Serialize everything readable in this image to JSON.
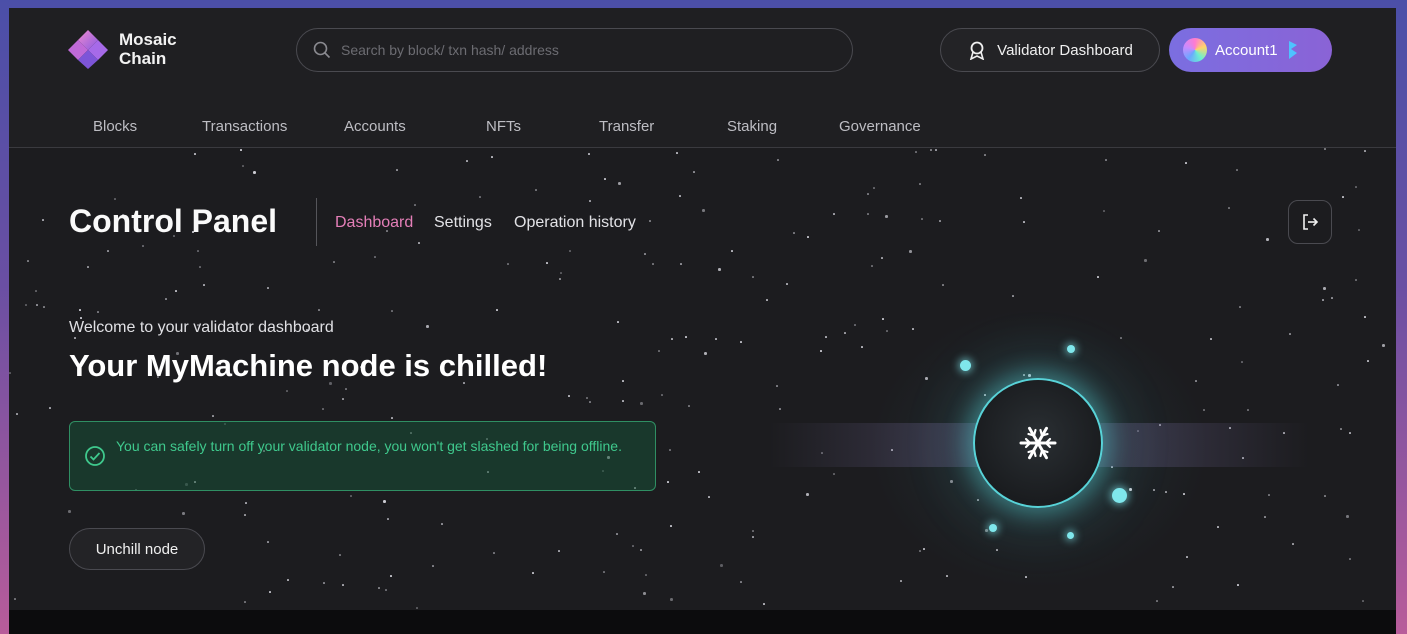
{
  "brand": {
    "line1": "Mosaic",
    "line2": "Chain"
  },
  "search": {
    "placeholder": "Search by block/ txn hash/ address",
    "icon": "search-icon"
  },
  "header": {
    "validator_button": "Validator Dashboard",
    "account_button": "Account1"
  },
  "nav": {
    "items": [
      "Blocks",
      "Transactions",
      "Accounts",
      "NFTs",
      "Transfer",
      "Staking",
      "Governance"
    ]
  },
  "control_panel": {
    "title": "Control Panel",
    "tabs": [
      {
        "label": "Dashboard",
        "active": true
      },
      {
        "label": "Settings",
        "active": false
      },
      {
        "label": "Operation history",
        "active": false
      }
    ]
  },
  "main": {
    "welcome": "Welcome to your validator dashboard",
    "headline": "Your MyMachine node is chilled!",
    "alert": "You can safely turn off your validator node, you won't get slashed for being offline.",
    "unchill_button": "Unchill node"
  },
  "colors": {
    "accent_pink": "#e47fb8",
    "success_green": "#3fc98d",
    "node_cyan": "#58d3d8",
    "account_purple": "#7b6ee0"
  }
}
